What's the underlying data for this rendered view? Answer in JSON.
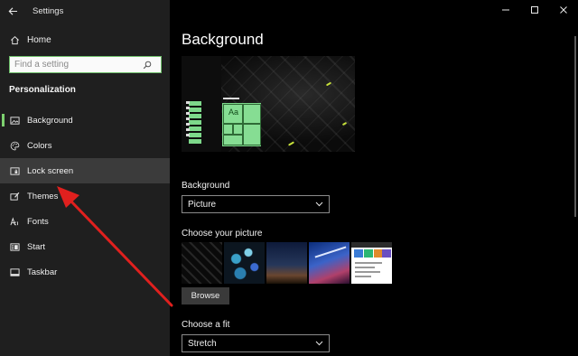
{
  "window": {
    "title": "Settings"
  },
  "sidebar": {
    "home_label": "Home",
    "search_placeholder": "Find a setting",
    "section_title": "Personalization",
    "items": [
      {
        "label": "Background",
        "icon": "picture-icon",
        "selected": true
      },
      {
        "label": "Colors",
        "icon": "palette-icon",
        "selected": false
      },
      {
        "label": "Lock screen",
        "icon": "lock-screen-icon",
        "selected": false,
        "hovered": true
      },
      {
        "label": "Themes",
        "icon": "brush-icon",
        "selected": false
      },
      {
        "label": "Fonts",
        "icon": "fonts-icon",
        "selected": false
      },
      {
        "label": "Start",
        "icon": "start-icon",
        "selected": false
      },
      {
        "label": "Taskbar",
        "icon": "taskbar-icon",
        "selected": false
      }
    ]
  },
  "main": {
    "title": "Background",
    "preview_tile_text": "Aa",
    "background_label": "Background",
    "background_value": "Picture",
    "choose_picture_label": "Choose your picture",
    "browse_label": "Browse",
    "fit_label": "Choose a fit",
    "fit_value": "Stretch"
  },
  "colors": {
    "accent": "#7dd16f",
    "sidebar_bg": "#1f1f1f",
    "main_bg": "#000000",
    "annotation_arrow": "#e0201e"
  }
}
